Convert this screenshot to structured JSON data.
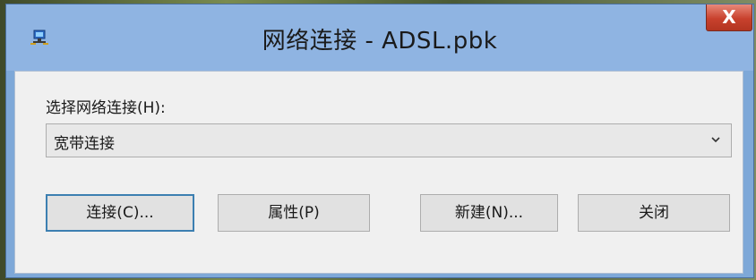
{
  "window": {
    "title": "网络连接 - ADSL.pbk",
    "close_glyph": "X",
    "icon": "network-connection-icon"
  },
  "dialog": {
    "select_label": "选择网络连接(H):",
    "selected_connection": "宽带连接",
    "dropdown_icon": "chevron-down-icon"
  },
  "buttons": {
    "connect": "连接(C)...",
    "properties": "属性(P)",
    "new": "新建(N)...",
    "close": "关闭"
  },
  "colors": {
    "title_bar": "#8fb4e2",
    "close_button": "#c8412d",
    "client_bg": "#f0f0f0",
    "default_button_border": "#3c7fb1"
  }
}
